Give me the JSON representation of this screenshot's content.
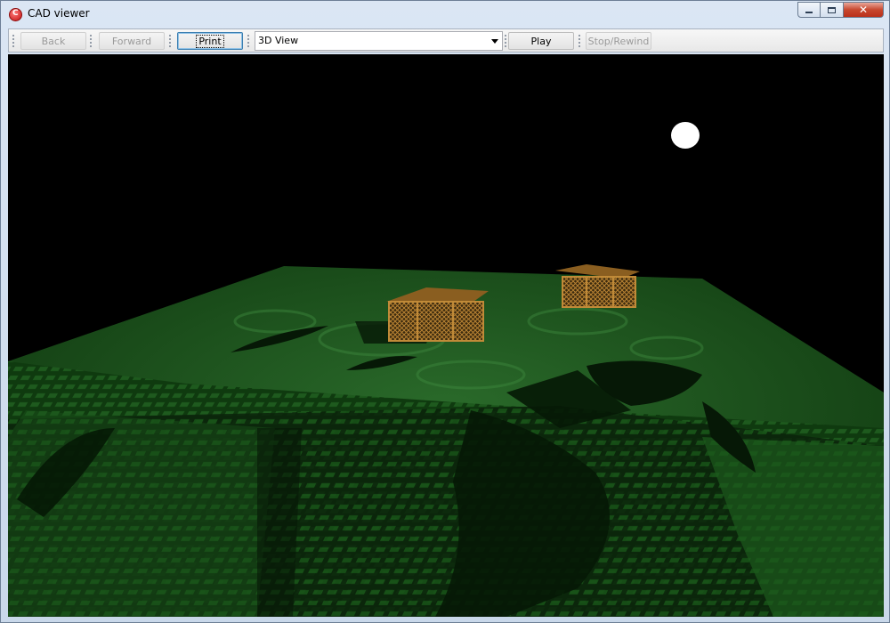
{
  "window": {
    "title": "CAD viewer",
    "icon": "cad-app-icon",
    "controls": {
      "minimize": "minimize-icon",
      "maximize": "maximize-icon",
      "close": "close-icon"
    }
  },
  "toolbar": {
    "back_label": "Back",
    "forward_label": "Forward",
    "print_label": "Print",
    "view_selected": "3D View",
    "play_label": "Play",
    "stop_label": "Stop/Rewind"
  },
  "viewport": {
    "content": "3d-terrain-scene",
    "colors": {
      "background": "#000000",
      "terrain": "#0f3a0f",
      "buildings": "#a6722a",
      "light": "#ffffff"
    }
  }
}
